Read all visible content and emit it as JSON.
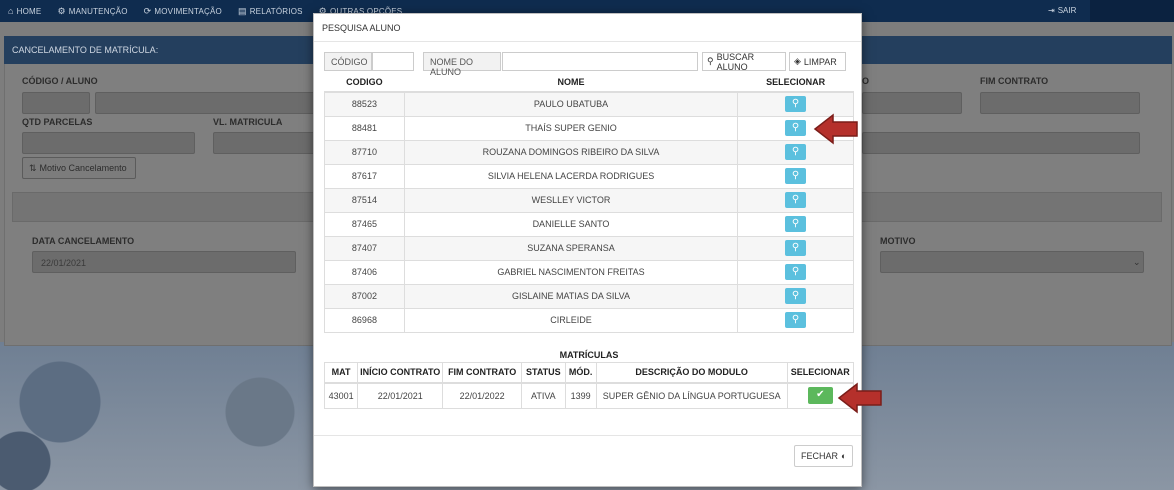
{
  "nav": {
    "items": [
      {
        "icon": "home-icon",
        "glyph": "⌂",
        "label": "HOME"
      },
      {
        "icon": "gear-icon",
        "glyph": "⚙",
        "label": "MANUTENÇÃO"
      },
      {
        "icon": "refresh-icon",
        "glyph": "⟳",
        "label": "MOVIMENTAÇÃO"
      },
      {
        "icon": "document-icon",
        "glyph": "▤",
        "label": "RELATÓRIOS"
      },
      {
        "icon": "cogs-icon",
        "glyph": "⚙",
        "label": "OUTRAS OPÇÕES"
      }
    ],
    "logout_label": "SAIR"
  },
  "background_page": {
    "panel_title": "CANCELAMENTO DE MATRÍCULA:",
    "labels": {
      "codigo_aluno": "CÓDIGO / ALUNO",
      "fim_contrato": "FIM CONTRATO",
      "qtd_parcelas": "QTD PARCELAS",
      "vl_matricula": "VL. MATRICULA",
      "data_cancelamento": "DATA CANCELAMENTO",
      "motivo": "MOTIVO",
      "partial_o": "O"
    },
    "motivo_button": "Motivo Cancelamento",
    "data_cancelamento_value": "22/01/2021"
  },
  "modal": {
    "title": "PESQUISA ALUNO",
    "search": {
      "codigo_label": "CÓDIGO",
      "nome_label": "NOME DO ALUNO",
      "buscar_label": "BUSCAR ALUNO",
      "limpar_label": "LIMPAR"
    },
    "alunos_headers": [
      "CODIGO",
      "NOME",
      "SELECIONAR"
    ],
    "alunos": [
      {
        "codigo": "88523",
        "nome": "PAULO UBATUBA"
      },
      {
        "codigo": "88481",
        "nome": "THAÍS SUPER GENIO"
      },
      {
        "codigo": "87710",
        "nome": "ROUZANA DOMINGOS RIBEIRO DA SILVA"
      },
      {
        "codigo": "87617",
        "nome": "SILVIA HELENA LACERDA RODRIGUES"
      },
      {
        "codigo": "87514",
        "nome": "WESLLEY VICTOR"
      },
      {
        "codigo": "87465",
        "nome": "DANIELLE SANTO"
      },
      {
        "codigo": "87407",
        "nome": "SUZANA SPERANSA"
      },
      {
        "codigo": "87406",
        "nome": "GABRIEL NASCIMENTON FREITAS"
      },
      {
        "codigo": "87002",
        "nome": "GISLAINE MATIAS DA SILVA"
      },
      {
        "codigo": "86968",
        "nome": "CIRLEIDE"
      }
    ],
    "matriculas_title": "MATRÍCULAS",
    "matriculas_headers": [
      "MAT",
      "INÍCIO CONTRATO",
      "FIM CONTRATO",
      "STATUS",
      "MÓD.",
      "DESCRIÇÃO DO MODULO",
      "SELECIONAR"
    ],
    "matriculas": [
      {
        "mat": "43001",
        "inicio": "22/01/2021",
        "fim": "22/01/2022",
        "status": "ATIVA",
        "mod": "1399",
        "descricao": "SUPER GÊNIO DA LÍNGUA PORTUGUESA"
      }
    ],
    "fechar_label": "FECHAR"
  },
  "colors": {
    "navbar": "#0f2c4f",
    "select_button": "#5bc0de",
    "confirm_button": "#5cb85c",
    "arrow": "#b5302b"
  }
}
